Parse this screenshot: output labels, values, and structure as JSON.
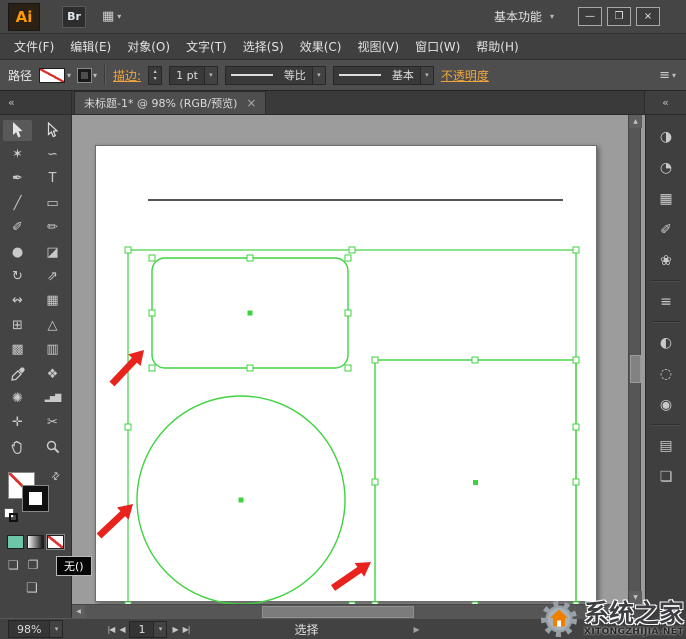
{
  "colors": {
    "selection_green": "#3ed33e",
    "annotation_red": "#e8231d",
    "link_orange": "#f0a43c",
    "logo_orange": "#ff9a00",
    "canvas_gray": "#9c9c9c",
    "artboard_white": "#ffffff"
  },
  "ui": {
    "chevron_down": "▾",
    "chevron_up": "▴",
    "collapse": "«",
    "scroll_up": "▲",
    "scroll_down": "▼",
    "scroll_left": "◀",
    "scroll_right": "▶"
  },
  "titlebar": {
    "app_logo": "Ai",
    "bridge_label": "Br",
    "workspace_icon": "▦",
    "workspace_label": "基本功能",
    "minimize": "—",
    "restore": "❐",
    "close": "×"
  },
  "menubar": {
    "items": [
      {
        "label": "文件(F)"
      },
      {
        "label": "编辑(E)"
      },
      {
        "label": "对象(O)"
      },
      {
        "label": "文字(T)"
      },
      {
        "label": "选择(S)"
      },
      {
        "label": "效果(C)"
      },
      {
        "label": "视图(V)"
      },
      {
        "label": "窗口(W)"
      },
      {
        "label": "帮助(H)"
      }
    ]
  },
  "controlbar": {
    "context_label": "路径",
    "stroke_link": "描边:",
    "stroke_weight": "1 pt",
    "width_profile": "等比",
    "brush_definition": "基本",
    "opacity_link": "不透明度",
    "menu_icon": "≡"
  },
  "tabbar": {
    "tab_title": "未标题-1* @ 98% (RGB/预览)",
    "tab_close": "×"
  },
  "toolbar": {
    "tools": [
      {
        "name": "selection"
      },
      {
        "name": "direct-selection"
      },
      {
        "name": "magic-wand",
        "glyph": "✶"
      },
      {
        "name": "lasso",
        "glyph": "∽"
      },
      {
        "name": "pen",
        "glyph": "✒"
      },
      {
        "name": "type",
        "glyph": "T"
      },
      {
        "name": "line-segment",
        "glyph": "╱"
      },
      {
        "name": "rectangle",
        "glyph": "▭"
      },
      {
        "name": "paintbrush",
        "glyph": "✐"
      },
      {
        "name": "pencil",
        "glyph": "✏"
      },
      {
        "name": "blob-brush",
        "glyph": "●"
      },
      {
        "name": "eraser",
        "glyph": "◪"
      },
      {
        "name": "rotate",
        "glyph": "↻"
      },
      {
        "name": "scale",
        "glyph": "⇗"
      },
      {
        "name": "width",
        "glyph": "↭"
      },
      {
        "name": "free-transform",
        "glyph": "▦"
      },
      {
        "name": "shape-builder",
        "glyph": "⊞"
      },
      {
        "name": "perspective-grid",
        "glyph": "△"
      },
      {
        "name": "mesh",
        "glyph": "▩"
      },
      {
        "name": "gradient",
        "glyph": "▥"
      },
      {
        "name": "eyedropper"
      },
      {
        "name": "blend",
        "glyph": "❖"
      },
      {
        "name": "symbol-sprayer",
        "glyph": "✺"
      },
      {
        "name": "column-graph",
        "glyph": "▂▅▇"
      },
      {
        "name": "artboard",
        "glyph": "✛"
      },
      {
        "name": "slice",
        "glyph": "✂"
      },
      {
        "name": "hand"
      },
      {
        "name": "zoom"
      }
    ],
    "swap_icon": "⇄",
    "draw_normal_icon": "❏",
    "draw_inside_icon": "❐",
    "screen_mode_icon": "❑"
  },
  "tooltip": {
    "text": "无()"
  },
  "right_dock": {
    "panels": [
      {
        "name": "color",
        "glyph": "◑"
      },
      {
        "name": "color-guide",
        "glyph": "◔"
      },
      {
        "name": "swatches",
        "glyph": "▦"
      },
      {
        "name": "brushes",
        "glyph": "✐"
      },
      {
        "name": "symbols",
        "glyph": "❀"
      },
      {
        "name": "stroke",
        "glyph": "≡"
      },
      {
        "name": "gradient",
        "glyph": "◐"
      },
      {
        "name": "transparency",
        "glyph": "◌"
      },
      {
        "name": "appearance",
        "glyph": "◉"
      },
      {
        "name": "layers",
        "glyph": "▤"
      },
      {
        "name": "artboards",
        "glyph": "❏"
      }
    ]
  },
  "statusbar": {
    "zoom": "98%",
    "nav_first": "|◀",
    "nav_prev": "◀",
    "artboard_number": "1",
    "nav_next": "▶",
    "nav_last": "▶|",
    "status_text": "选择",
    "flyout": "▶"
  },
  "watermark": {
    "title": "系统之家",
    "subtitle": "XITONGZHIJIA.NET"
  }
}
